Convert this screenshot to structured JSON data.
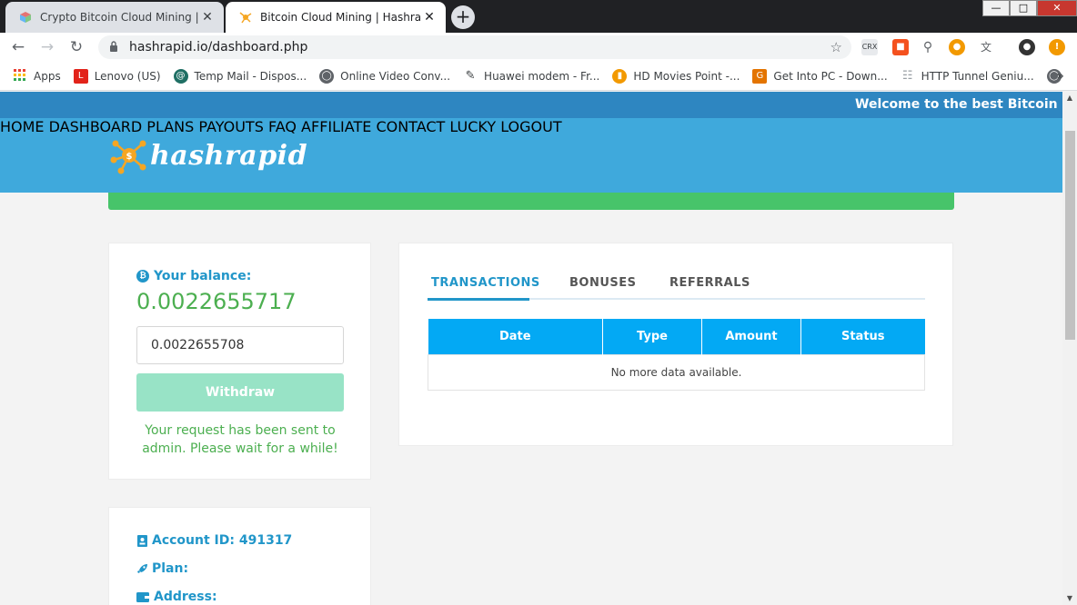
{
  "browser": {
    "tabs": [
      {
        "title": "Crypto Bitcoin Cloud Mining | Pi",
        "active": false
      },
      {
        "title": "Bitcoin Cloud Mining | Hashrapid",
        "active": true
      }
    ],
    "new_tab": "+",
    "close_glyph": "✕",
    "url": "hashrapid.io/dashboard.php",
    "bookmarks": [
      {
        "label": "Apps",
        "icon": "apps-grid-icon",
        "color": "#e94235"
      },
      {
        "label": "Lenovo (US)",
        "icon": "lenovo-icon",
        "color": "#e2231a"
      },
      {
        "label": "Temp Mail - Dispos...",
        "icon": "tempmail-icon",
        "color": "#1f6f64"
      },
      {
        "label": "Online Video Conv...",
        "icon": "globe-icon",
        "color": "#5f6368"
      },
      {
        "label": "Huawei modem - Fr...",
        "icon": "usb-modem-icon",
        "color": "#3c4043"
      },
      {
        "label": "HD Movies Point -...",
        "icon": "chart-icon",
        "color": "#f29900"
      },
      {
        "label": "Get Into PC - Down...",
        "icon": "getintopc-icon",
        "color": "#e37400"
      },
      {
        "label": "HTTP Tunnel Geniu...",
        "icon": "page-icon",
        "color": "#9aa0a6"
      }
    ],
    "more_glyph": "»"
  },
  "site": {
    "ticker": "Welcome to the best Bitcoin mining",
    "logo_text": "hashrapid",
    "menu": [
      "HOME",
      "DASHBOARD",
      "PLANS",
      "PAYOUTS",
      "FAQ",
      "AFFILIATE",
      "CONTACT",
      "LUCKY",
      "LOGOUT"
    ],
    "balance": {
      "label": "Your balance:",
      "value": "0.0022655717",
      "input_value": "0.0022655708",
      "button": "Withdraw",
      "message": "Your request has been sent to admin. Please wait for a while!"
    },
    "transactions": {
      "tabs": [
        "TRANSACTIONS",
        "BONUSES",
        "REFERRALS"
      ],
      "headers": [
        "Date",
        "Type",
        "Amount",
        "Status"
      ],
      "empty": "No more data available."
    },
    "account": {
      "id_label": "Account ID: 491317",
      "plan_label": "Plan:",
      "address_label": "Address:"
    }
  },
  "colors": {
    "ticker_bg": "#2e86c1",
    "navbar_bg": "#3fa9dc",
    "accent_blue": "#2196c9",
    "table_header": "#03a9f4",
    "green_text": "#4caf50",
    "withdraw_btn": "#98e3c6",
    "green_bar": "#47c46a"
  }
}
